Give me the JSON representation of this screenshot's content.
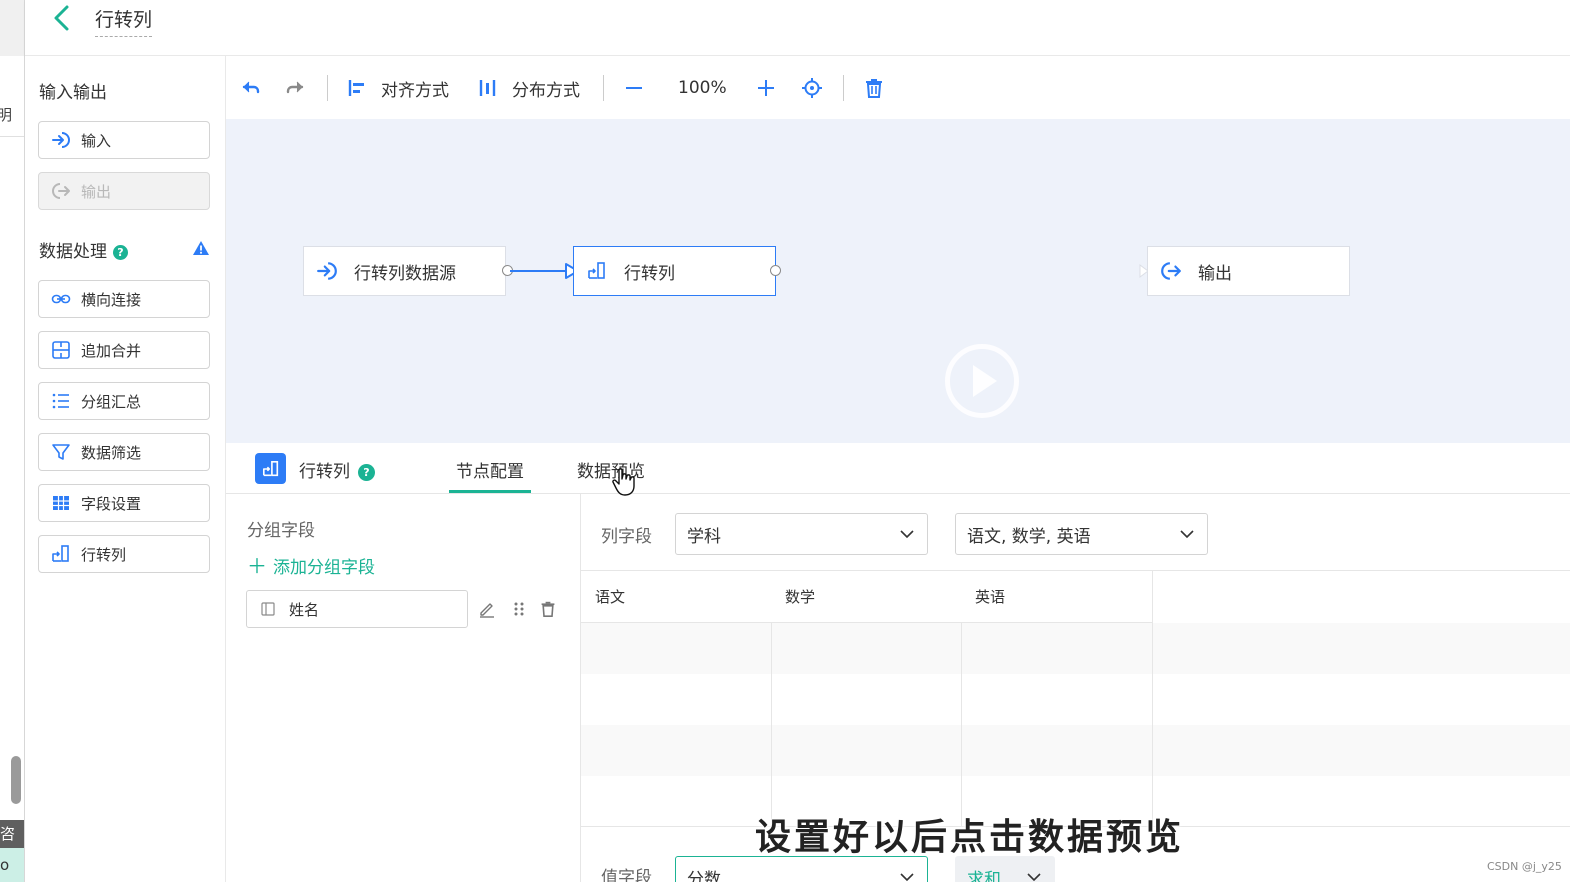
{
  "header": {
    "title": "行转列"
  },
  "left_strip": {
    "frag_top": "明",
    "frag_mid": "咨",
    "frag_bot": "o"
  },
  "sidebar": {
    "io_title": "输入输出",
    "io_items": [
      {
        "label": "输入",
        "icon": "input-arrow-icon",
        "disabled": false
      },
      {
        "label": "输出",
        "icon": "output-arrow-icon",
        "disabled": true
      }
    ],
    "processing_title": "数据处理",
    "help_glyph": "?",
    "warning_glyph": "!",
    "processing_items": [
      {
        "label": "横向连接",
        "icon": "link-icon"
      },
      {
        "label": "追加合并",
        "icon": "merge-icon"
      },
      {
        "label": "分组汇总",
        "icon": "list-icon"
      },
      {
        "label": "数据筛选",
        "icon": "filter-icon"
      },
      {
        "label": "字段设置",
        "icon": "table-icon"
      },
      {
        "label": "行转列",
        "icon": "row-to-col-icon"
      }
    ]
  },
  "toolbar": {
    "align_label": "对齐方式",
    "distribute_label": "分布方式",
    "zoom": "100%"
  },
  "canvas": {
    "nodes": [
      {
        "label": "行转列数据源",
        "icon": "input-arrow-icon"
      },
      {
        "label": "行转列",
        "icon": "row-to-col-icon"
      },
      {
        "label": "输出",
        "icon": "output-arrow-icon"
      }
    ]
  },
  "panel": {
    "title": "行转列",
    "tabs": [
      "节点配置",
      "数据预览"
    ],
    "active_tab": 0,
    "group_field_label": "分组字段",
    "add_group_label": "添加分组字段",
    "group_field_value": "姓名",
    "column_field_label": "列字段",
    "column_field_value": "学科",
    "column_values": "语文, 数学, 英语",
    "grid_headers": [
      "语文",
      "数学",
      "英语"
    ],
    "value_field_label": "值字段",
    "value_field_value": "分数",
    "aggregate_value": "求和"
  },
  "overlay": {
    "subtitle": "设置好以后点击数据预览",
    "watermark": "CSDN @j_y25"
  },
  "colors": {
    "accent": "#1bb394",
    "primary": "#2d7cf6",
    "canvas_bg": "#eef2fa",
    "warning": "#2d7cf6"
  }
}
